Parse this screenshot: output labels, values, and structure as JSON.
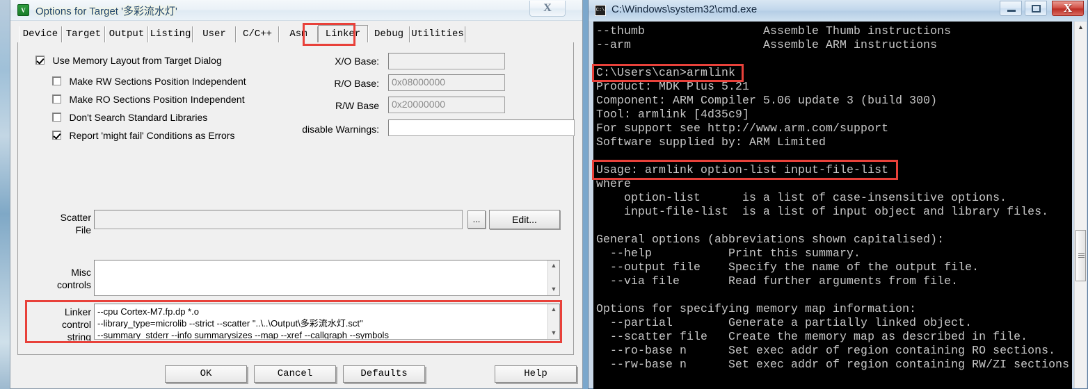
{
  "dialog": {
    "title": "Options for Target '多彩流水灯'",
    "icon": "keil-uvision-icon",
    "close_label": "X",
    "tabs": [
      {
        "label": "Device",
        "selected": false
      },
      {
        "label": "Target",
        "selected": false
      },
      {
        "label": "Output",
        "selected": false
      },
      {
        "label": "Listing",
        "selected": false
      },
      {
        "label": "User",
        "selected": false
      },
      {
        "label": "C/C++",
        "selected": false
      },
      {
        "label": "Asm",
        "selected": false
      },
      {
        "label": "Linker",
        "selected": true
      },
      {
        "label": "Debug",
        "selected": false
      },
      {
        "label": "Utilities",
        "selected": false
      }
    ],
    "checkboxes": [
      {
        "label": "Use Memory Layout from Target Dialog",
        "checked": true
      },
      {
        "label": "Make RW Sections Position Independent",
        "checked": false
      },
      {
        "label": "Make RO Sections Position Independent",
        "checked": false
      },
      {
        "label": "Don't Search Standard Libraries",
        "checked": false
      },
      {
        "label": "Report 'might fail' Conditions as Errors",
        "checked": true
      }
    ],
    "fields": [
      {
        "label": "X/O Base:",
        "value": "",
        "disabled": true
      },
      {
        "label": "R/O Base:",
        "value": "0x08000000",
        "disabled": true
      },
      {
        "label": "R/W Base",
        "value": "0x20000000",
        "disabled": true
      },
      {
        "label": "disable Warnings:",
        "value": "",
        "disabled": false
      }
    ],
    "scatter": {
      "label_line1": "Scatter",
      "label_line2": "File",
      "value": "",
      "browse_label": "...",
      "edit_label": "Edit..."
    },
    "misc": {
      "label_line1": "Misc",
      "label_line2": "controls",
      "lines": []
    },
    "linker_control_string": {
      "label_line1": "Linker",
      "label_line2": "control",
      "label_line3": "string",
      "lines": [
        "--cpu Cortex-M7.fp.dp *.o",
        "--library_type=microlib --strict --scatter \"..\\..\\Output\\多彩流水灯.sct\"",
        "--summary_stderr --info summarysizes --map --xref --callgraph --symbols"
      ]
    },
    "buttons": [
      {
        "label": "OK"
      },
      {
        "label": "Cancel"
      },
      {
        "label": "Defaults"
      },
      {
        "label": "Help"
      }
    ]
  },
  "cmd": {
    "title": "C:\\Windows\\system32\\cmd.exe",
    "icon": "console-icon",
    "window_buttons": {
      "minimize": "minimize-icon",
      "maximize": "maximize-icon",
      "close": "X"
    },
    "lines": [
      "--thumb                 Assemble Thumb instructions",
      "--arm                   Assemble ARM instructions",
      "",
      "C:\\Users\\can>armlink",
      "Product: MDK Plus 5.21",
      "Component: ARM Compiler 5.06 update 3 (build 300)",
      "Tool: armlink [4d35c9]",
      "For support see http://www.arm.com/support",
      "Software supplied by: ARM Limited",
      "",
      "Usage: armlink option-list input-file-list",
      "where",
      "    option-list      is a list of case-insensitive options.",
      "    input-file-list  is a list of input object and library files.",
      "",
      "General options (abbreviations shown capitalised):",
      "  --help           Print this summary.",
      "  --output file    Specify the name of the output file.",
      "  --via file       Read further arguments from file.",
      "",
      "Options for specifying memory map information:",
      "  --partial        Generate a partially linked object.",
      "  --scatter file   Create the memory map as described in file.",
      "  --ro-base n      Set exec addr of region containing RO sections.",
      "  --rw-base n      Set exec addr of region containing RW/ZI sections"
    ],
    "scrollbar": {
      "up_arrow": "▲",
      "down_arrow": "▼"
    }
  },
  "annotations": {
    "highlight_color": "#e8413a",
    "regions": [
      "linker-tab",
      "armlink-command",
      "usage-line",
      "linker-control-string"
    ]
  }
}
